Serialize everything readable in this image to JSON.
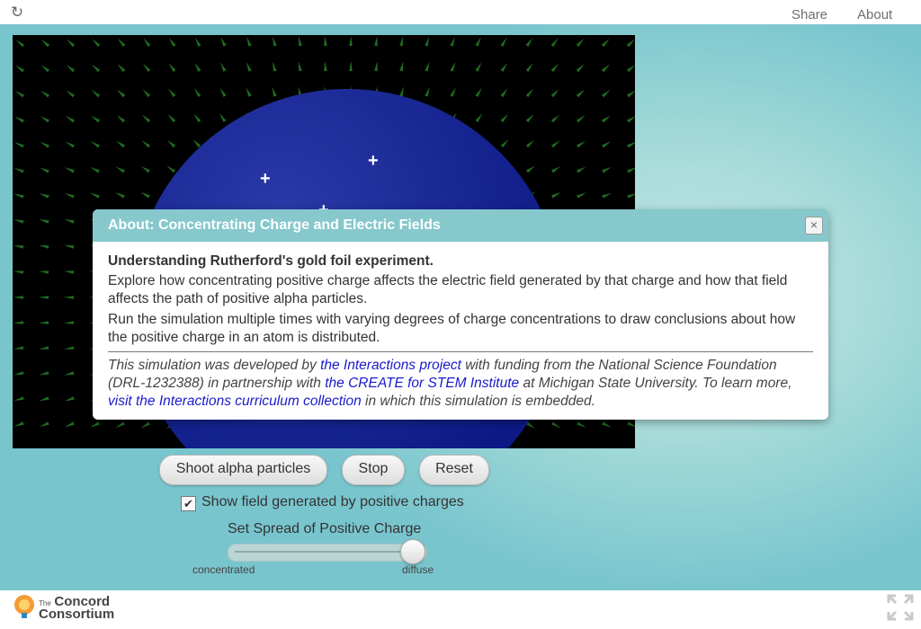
{
  "topbar": {
    "share_label": "Share",
    "about_label": "About"
  },
  "simulation": {
    "charges": [
      "+",
      "+",
      "+"
    ],
    "field_color": "#1f6b1f",
    "atom_color": "#0d1a86"
  },
  "controls": {
    "shoot_label": "Shoot alpha particles",
    "stop_label": "Stop",
    "reset_label": "Reset",
    "show_field_label": "Show field generated by positive charges",
    "show_field_checked": true,
    "slider_title": "Set Spread of Positive Charge",
    "slider_min_label": "concentrated",
    "slider_max_label": "diffuse",
    "slider_value": 1.0
  },
  "about_dialog": {
    "title": "About: Concentrating Charge and Electric Fields",
    "heading": "Understanding Rutherford's gold foil experiment.",
    "para1": "Explore how concentrating positive charge affects the electric field generated by that charge and how that field affects the path of positive alpha particles.",
    "para2": "Run the simulation multiple times with varying degrees of charge concentrations to draw conclusions about how the positive charge in an atom is distributed.",
    "credit_1": "This simulation was developed by ",
    "credit_link_1": "the Interactions project",
    "credit_2": " with funding from the National Science Foundation (DRL-1232388) in partnership with ",
    "credit_link_2": "the CREATE for STEM Institute",
    "credit_3": " at Michigan State University. To learn more, ",
    "credit_link_3": "visit the Interactions curriculum collection",
    "credit_4": " in which this simulation is embedded.",
    "close_icon": "×"
  },
  "footer": {
    "logo_line1": "The",
    "logo_line2": "Concord",
    "logo_line3": "Consortium"
  },
  "colors": {
    "accent": "#86c8cc",
    "link": "#1a1acc"
  }
}
